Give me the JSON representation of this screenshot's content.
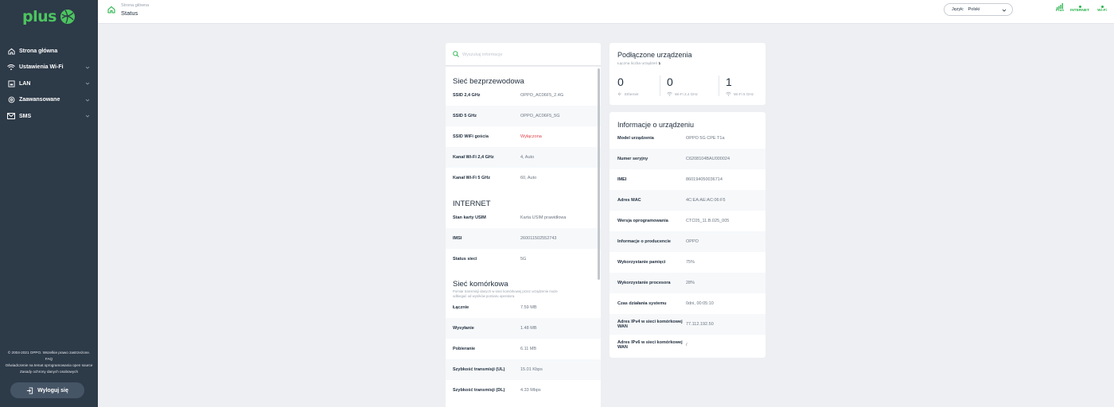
{
  "brand": {
    "name": "plus",
    "color": "#4cc55f"
  },
  "sidebar": {
    "items": [
      {
        "label": "Strona główna",
        "icon": "home-icon"
      },
      {
        "label": "Ustawienia Wi-Fi",
        "icon": "wifi-icon"
      },
      {
        "label": "LAN",
        "icon": "lan-icon"
      },
      {
        "label": "Zaawansowane",
        "icon": "gear-icon"
      },
      {
        "label": "SMS",
        "icon": "mail-icon"
      }
    ],
    "footer": {
      "copyright": "© 2004-2021 OPPO. Wszelkie prawo zastrzeżone.",
      "faq": "FAQ",
      "open_source": "Oświadczenie na temat oprogramowania open source",
      "privacy": "Zasady ochrony danych osobowych"
    },
    "logout_label": "Wyloguj się"
  },
  "header": {
    "breadcrumb": "Strona główna",
    "title": "Status",
    "language": {
      "label": "Język:",
      "value": "Polski"
    },
    "indicators": [
      {
        "label": "Plus",
        "icon": "signal-bars-icon"
      },
      {
        "label": "INTERNET",
        "icon": "dot-icon"
      },
      {
        "label": "Wi-Fi",
        "icon": "dot-icon"
      }
    ]
  },
  "search": {
    "placeholder": "Wyszukaj informacje",
    "value": ""
  },
  "wireless": {
    "title": "Sieć bezprzewodowa",
    "rows": [
      {
        "label": "SSID 2,4 GHz",
        "value": "OPPO_AC06F5_2.4G"
      },
      {
        "label": "SSID 5 GHz",
        "value": "OPPO_AC06F5_5G"
      },
      {
        "label": "SSID WiFi gościa",
        "value": "Wyłączona"
      },
      {
        "label": "Kanał Wi-Fi 2,4 GHz",
        "value": "4, Auto"
      },
      {
        "label": "Kanał Wi-Fi 5 GHz",
        "value": "60, Auto"
      }
    ]
  },
  "internet": {
    "title": "INTERNET",
    "rows": [
      {
        "label": "Stan karty USIM",
        "value": "Karta USIM prawidłowa"
      },
      {
        "label": "IMSI",
        "value": "260011502552743"
      },
      {
        "label": "Status sieci",
        "value": "5G"
      }
    ]
  },
  "cellular": {
    "title": "Sieć komórkowa",
    "subtitle": "Pomiar transmisji danych w sieci komórkowej przez urządzenie może odbiegać od wyników pomiaru operatora.",
    "rows": [
      {
        "label": "Łącznie",
        "value": "7.59 MB"
      },
      {
        "label": "Wysyłanie",
        "value": "1.48 MB"
      },
      {
        "label": "Pobieranie",
        "value": "6.11 MB"
      },
      {
        "label": "Szybkość transmisji (UL)",
        "value": "15.01 Kbps"
      },
      {
        "label": "Szybkość transmisji (DL)",
        "value": "4.33 Mbps"
      }
    ]
  },
  "connected": {
    "title": "Podłączone urządzenia",
    "total_label": "Łączna liczba urządzeń",
    "total_value": "1",
    "counts": [
      {
        "value": "0",
        "label": "Ethernet",
        "icon": "ethernet-icon"
      },
      {
        "value": "0",
        "label": "Wi-Fi 2,4 GHz",
        "icon": "wifi-icon"
      },
      {
        "value": "1",
        "label": "Wi-Fi 5 GHz",
        "icon": "wifi-icon"
      }
    ]
  },
  "device_info": {
    "title": "Informacje o urządzeniu",
    "rows": [
      {
        "label": "Model urządzenia",
        "value": "OPPO 5G CPE T1a"
      },
      {
        "label": "Numer seryjny",
        "value": "C6208104BAU000024"
      },
      {
        "label": "IMEI",
        "value": "860194050036714"
      },
      {
        "label": "Adres MAC",
        "value": "4C:EA:AE:AC:06:F5"
      },
      {
        "label": "Wersja oprogramowania",
        "value": "CTC05_11.B.025_005"
      },
      {
        "label": "Informacje o producencie",
        "value": "OPPO"
      },
      {
        "label": "Wykorzystanie pamięci",
        "value": "75%"
      },
      {
        "label": "Wykorzystanie procesora",
        "value": "28%"
      },
      {
        "label": "Czas działania systemu",
        "value": "0dni, 00:05:10"
      },
      {
        "label": "Adres IPv4 w sieci komórkowej WAN",
        "value": "77.112.192.50"
      },
      {
        "label": "Adres IPv6 w sieci komórkowej WAN",
        "value": "/"
      }
    ]
  },
  "colors": {
    "sidebar_bg": "#2d3a48",
    "accent_green": "#27b34b",
    "disabled_red": "#e0454c"
  }
}
